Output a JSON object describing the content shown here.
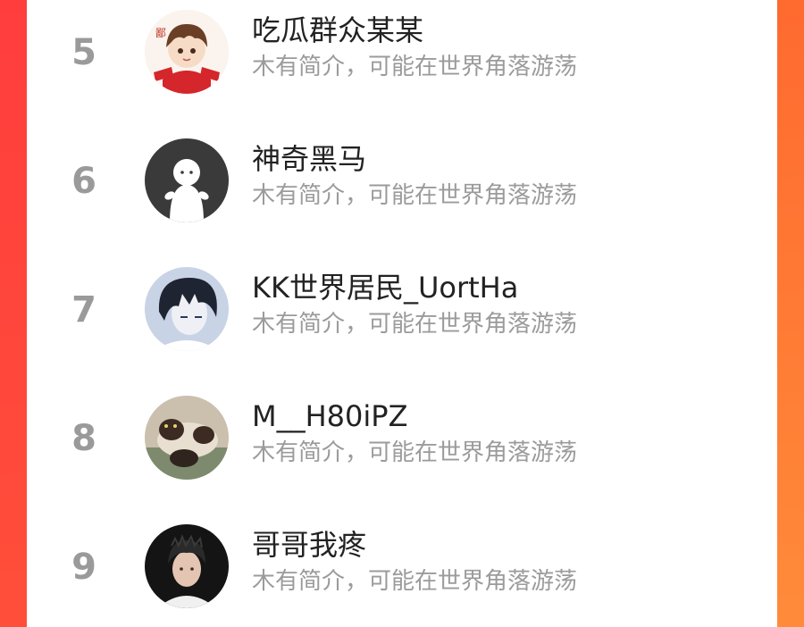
{
  "theme": {
    "accent_left": "#ff3d3d",
    "accent_right": "#ff8b3a",
    "rank_color": "#9a9a9a",
    "name_color": "#222222",
    "bio_color": "#9b9b9b"
  },
  "ranking": {
    "items": [
      {
        "rank": "5",
        "name": "吃瓜群众某某",
        "bio": "木有简介，可能在世界角落游荡",
        "avatar": "anime-boy-avatar"
      },
      {
        "rank": "6",
        "name": "神奇黑马",
        "bio": "木有简介，可能在世界角落游荡",
        "avatar": "default-ghost-avatar"
      },
      {
        "rank": "7",
        "name": "KK世界居民_UortHa",
        "bio": "木有简介，可能在世界角落游荡",
        "avatar": "dark-hair-anime-avatar"
      },
      {
        "rank": "8",
        "name": "M__H80iPZ",
        "bio": "木有简介，可能在世界角落游荡",
        "avatar": "cat-photo-avatar"
      },
      {
        "rank": "9",
        "name": "哥哥我疼",
        "bio": "木有简介，可能在世界角落游荡",
        "avatar": "person-photo-avatar"
      }
    ]
  }
}
